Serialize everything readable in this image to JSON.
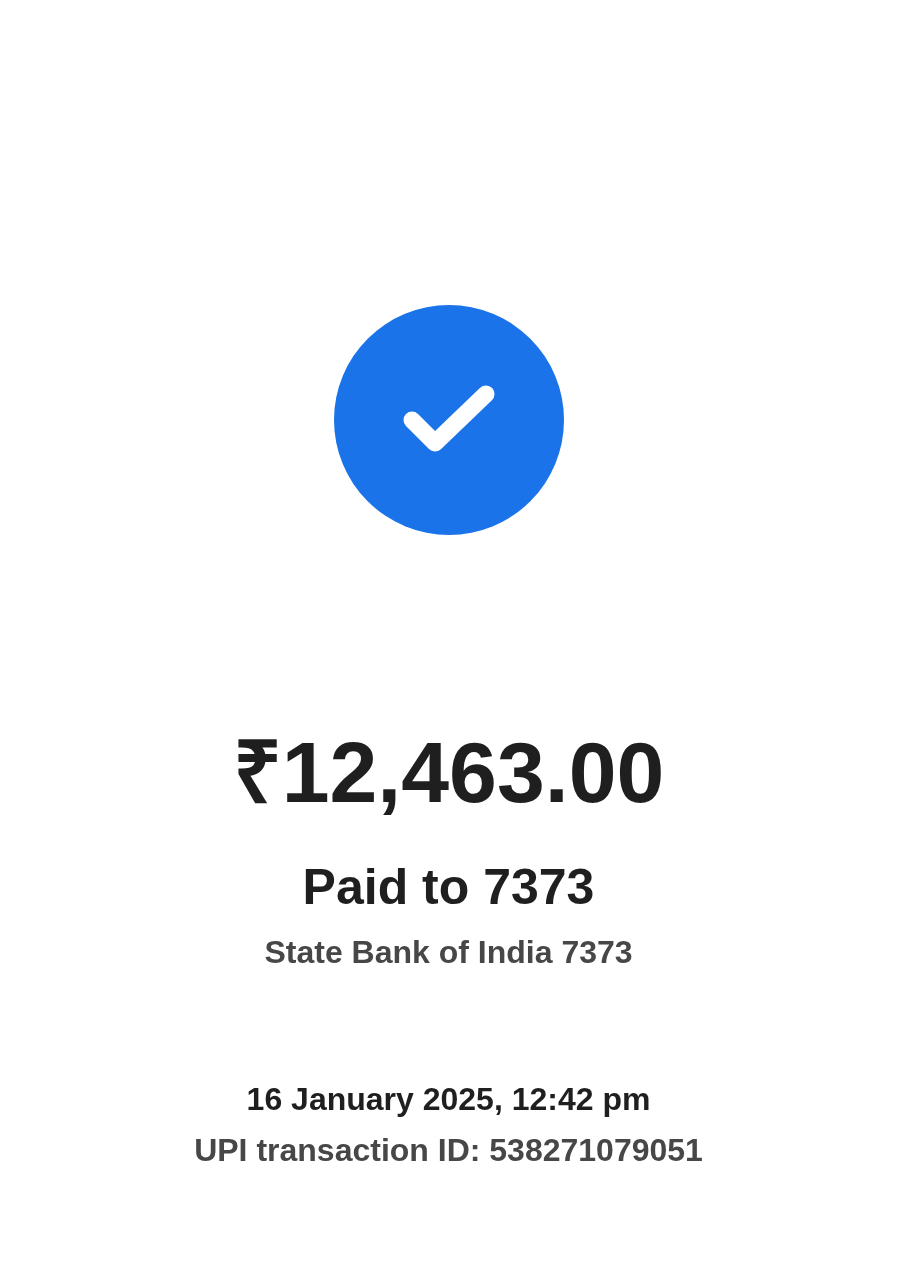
{
  "success": true,
  "amount": "₹12,463.00",
  "payee": "Paid to 7373",
  "bank": "State Bank of India 7373",
  "datetime": "16 January 2025, 12:42 pm",
  "transaction_id": "UPI transaction ID: 538271079051"
}
